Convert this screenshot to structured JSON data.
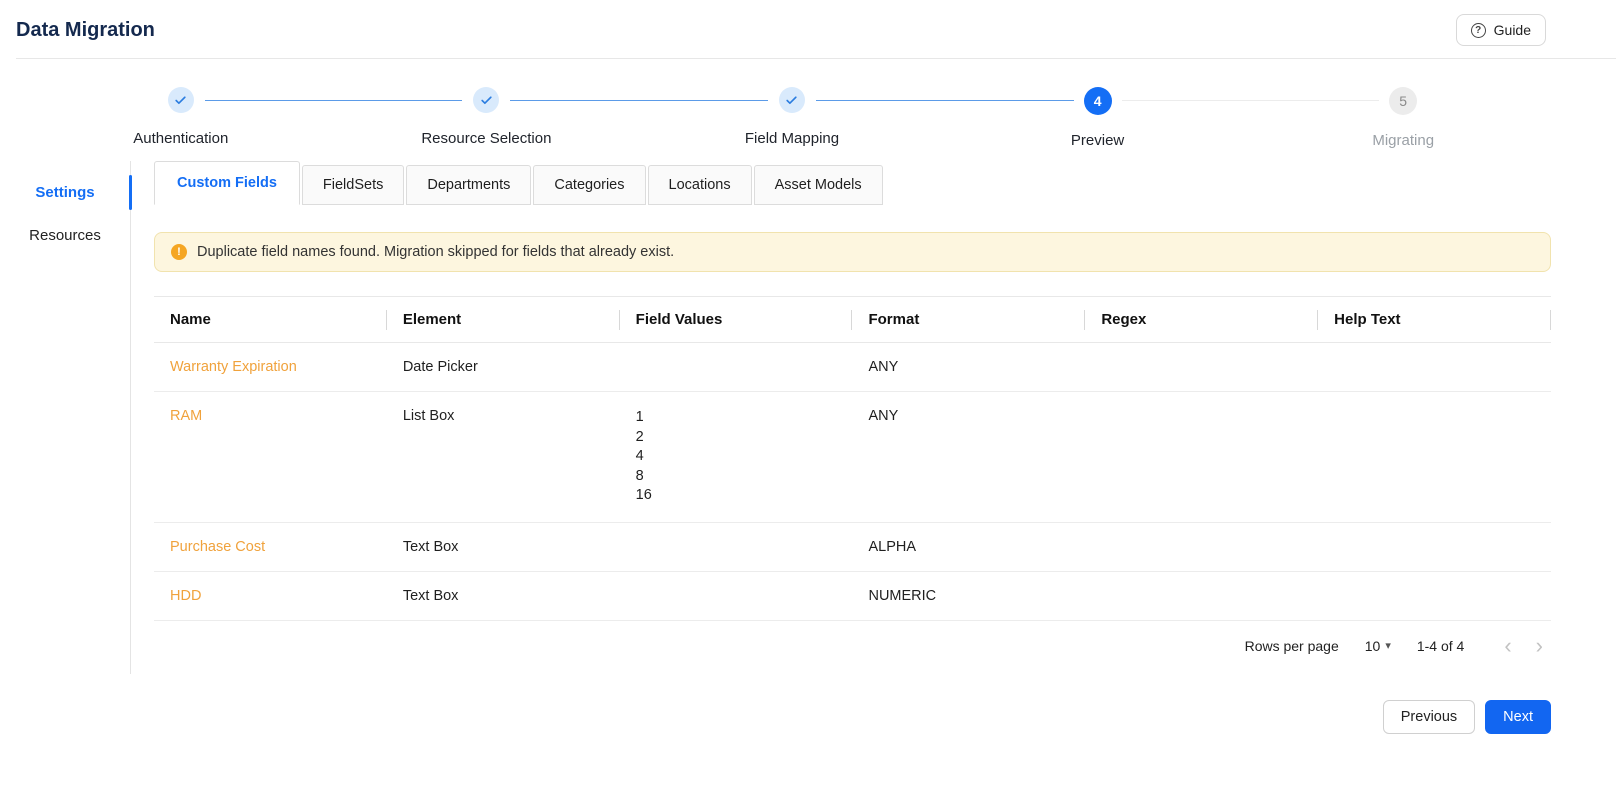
{
  "header": {
    "title": "Data Migration",
    "guide_label": "Guide"
  },
  "stepper": {
    "steps": [
      {
        "label": "Authentication",
        "state": "done"
      },
      {
        "label": "Resource Selection",
        "state": "done"
      },
      {
        "label": "Field Mapping",
        "state": "done"
      },
      {
        "label": "Preview",
        "state": "active",
        "number": "4"
      },
      {
        "label": "Migrating",
        "state": "pending",
        "number": "5"
      }
    ]
  },
  "sidebar": {
    "items": [
      {
        "label": "Settings",
        "active": true
      },
      {
        "label": "Resources",
        "active": false
      }
    ]
  },
  "tabs": [
    {
      "label": "Custom Fields",
      "active": true
    },
    {
      "label": "FieldSets",
      "active": false
    },
    {
      "label": "Departments",
      "active": false
    },
    {
      "label": "Categories",
      "active": false
    },
    {
      "label": "Locations",
      "active": false
    },
    {
      "label": "Asset Models",
      "active": false
    }
  ],
  "banner": {
    "text": "Duplicate field names found. Migration skipped for fields that already exist."
  },
  "table": {
    "columns": [
      "Name",
      "Element",
      "Field Values",
      "Format",
      "Regex",
      "Help Text"
    ],
    "rows": [
      {
        "name": "Warranty Expiration",
        "element": "Date Picker",
        "field_values": "",
        "format": "ANY",
        "regex": "",
        "help_text": ""
      },
      {
        "name": "RAM",
        "element": "List Box",
        "field_values": "1\n2\n4\n8\n16",
        "format": "ANY",
        "regex": "",
        "help_text": ""
      },
      {
        "name": "Purchase Cost",
        "element": "Text Box",
        "field_values": "",
        "format": "ALPHA",
        "regex": "",
        "help_text": ""
      },
      {
        "name": "HDD",
        "element": "Text Box",
        "field_values": "",
        "format": "NUMERIC",
        "regex": "",
        "help_text": ""
      }
    ],
    "pagination": {
      "rows_per_page_label": "Rows per page",
      "rows_per_page_value": "10",
      "range_label": "1-4 of 4"
    }
  },
  "footer": {
    "previous_label": "Previous",
    "next_label": "Next"
  },
  "icons": {
    "guide": "question-circle-icon",
    "warning": "warning-icon",
    "check": "check-icon"
  },
  "colors": {
    "primary_blue": "#146ef5",
    "next_button_blue": "#1266f1",
    "link_orange": "#f0a23c",
    "warning_orange": "#f5a623",
    "banner_background": "#fdf6df",
    "title_navy": "#14294e"
  }
}
